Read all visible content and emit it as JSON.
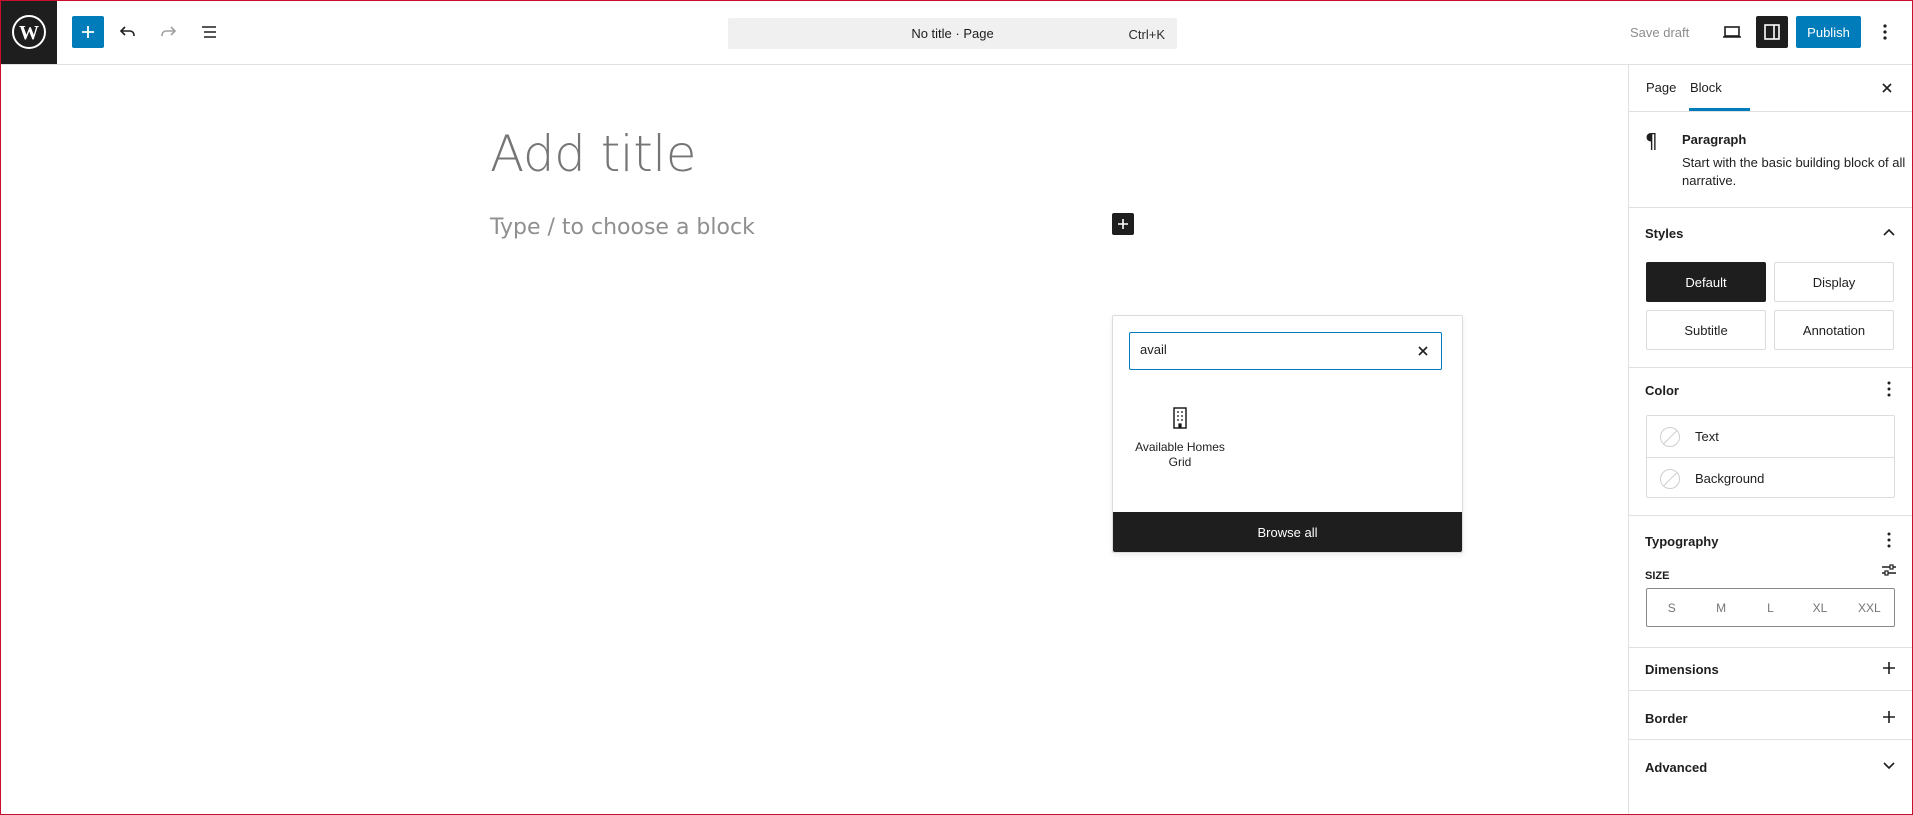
{
  "header": {
    "document_title": "No title · Page",
    "shortcut": "Ctrl+K",
    "save_draft_label": "Save draft",
    "publish_label": "Publish",
    "icons": {
      "logo": "wordpress-logo-icon",
      "add": "plus-icon",
      "undo": "undo-icon",
      "redo": "redo-icon",
      "list_view": "list-view-icon",
      "preview": "laptop-icon",
      "settings": "sidebar-settings-icon",
      "more": "vertical-ellipsis-icon"
    }
  },
  "editor": {
    "title_placeholder": "Add title",
    "block_placeholder": "Type / to choose a block"
  },
  "quick_inserter": {
    "search_value": "avail",
    "results": [
      {
        "label": "Available Homes Grid",
        "icon": "building-icon"
      }
    ],
    "browse_all_label": "Browse all"
  },
  "sidebar": {
    "tabs": [
      {
        "label": "Page",
        "active": false
      },
      {
        "label": "Block",
        "active": true
      }
    ],
    "block_card": {
      "title": "Paragraph",
      "description": "Start with the basic building block of all narrative.",
      "icon": "pilcrow-icon"
    },
    "styles": {
      "title": "Styles",
      "options": [
        {
          "label": "Default",
          "active": true
        },
        {
          "label": "Display",
          "active": false
        },
        {
          "label": "Subtitle",
          "active": false
        },
        {
          "label": "Annotation",
          "active": false
        }
      ]
    },
    "color": {
      "title": "Color",
      "items": [
        {
          "label": "Text"
        },
        {
          "label": "Background"
        }
      ]
    },
    "typography": {
      "title": "Typography",
      "size_label": "SIZE",
      "sizes": [
        "S",
        "M",
        "L",
        "XL",
        "XXL"
      ]
    },
    "dimensions": {
      "title": "Dimensions"
    },
    "border": {
      "title": "Border"
    },
    "advanced": {
      "title": "Advanced"
    }
  },
  "colors": {
    "accent": "#007cba",
    "dark": "#1e1e1e",
    "frame": "#c8102e"
  }
}
